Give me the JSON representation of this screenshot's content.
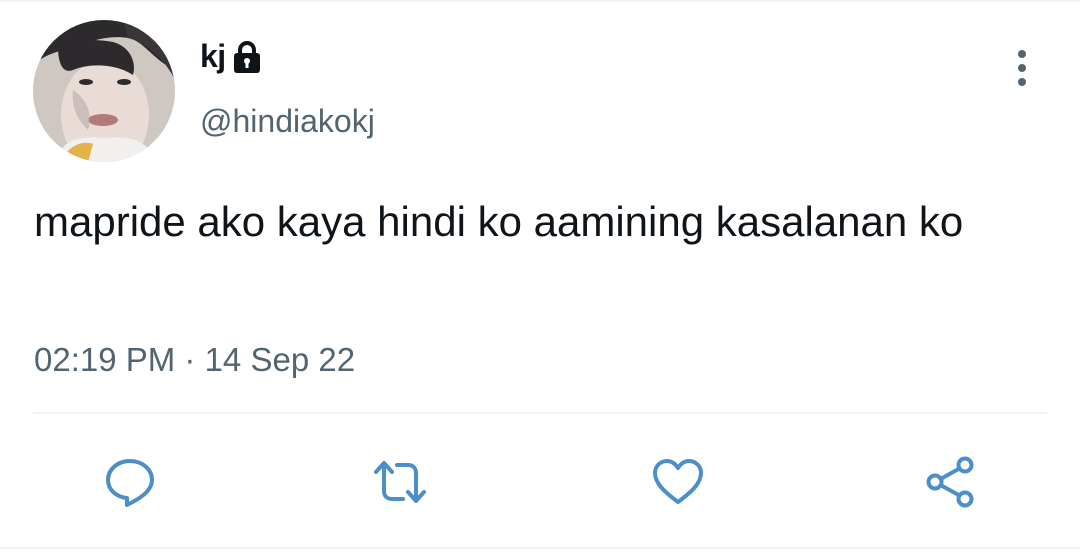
{
  "tweet": {
    "author": {
      "display_name": "kj",
      "handle": "@hindiakokj",
      "protected_icon": "lock-icon"
    },
    "text": "mapride ako kaya hindi ko aamining kasalanan ko",
    "time": "02:19 PM",
    "separator": " · ",
    "date": "14 Sep 22"
  },
  "actions": {
    "reply_icon": "reply-icon",
    "retweet_icon": "retweet-icon",
    "like_icon": "heart-icon",
    "share_icon": "share-icon"
  },
  "menu_icon": "more-vertical-icon",
  "colors": {
    "text_primary": "#0f1419",
    "text_secondary": "#536471",
    "icon_accent": "#4c8ec7",
    "divider": "#eff3f4"
  }
}
